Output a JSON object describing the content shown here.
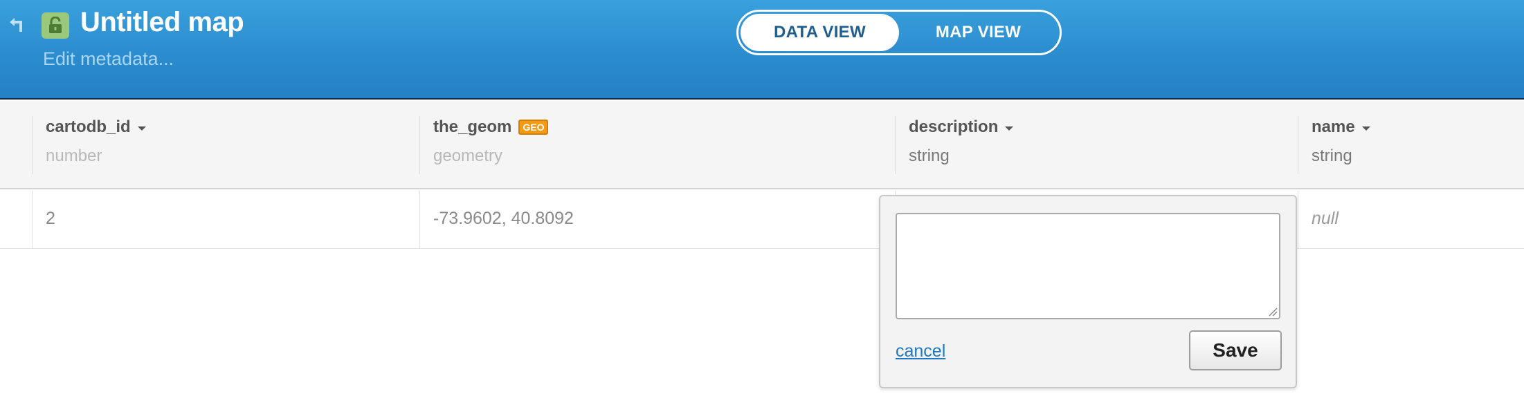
{
  "header": {
    "title": "Untitled map",
    "edit_metadata": "Edit metadata...",
    "view_toggle": {
      "data_view": "DATA VIEW",
      "map_view": "MAP VIEW",
      "active": "data_view"
    }
  },
  "colors": {
    "header_top": "#3aa0dd",
    "header_bottom": "#2480c4",
    "lock_badge": "#9bc97b",
    "geo_badge": "#f59a12",
    "link": "#1f78c1"
  },
  "icons": {
    "back": "back-arrow-icon",
    "lock": "unlocked-padlock-icon",
    "sort": "caret-down-icon"
  },
  "table": {
    "columns": [
      {
        "name": "cartodb_id",
        "type": "number",
        "sortable": true
      },
      {
        "name": "the_geom",
        "type": "geometry",
        "badge": "GEO"
      },
      {
        "name": "description",
        "type": "string",
        "sortable": true
      },
      {
        "name": "name",
        "type": "string",
        "sortable": true
      }
    ],
    "rows": [
      {
        "cartodb_id": "2",
        "the_geom": "-73.9602, 40.8092",
        "description": "",
        "name": "null"
      }
    ]
  },
  "editor": {
    "value": "",
    "cancel_label": "cancel",
    "save_label": "Save"
  }
}
